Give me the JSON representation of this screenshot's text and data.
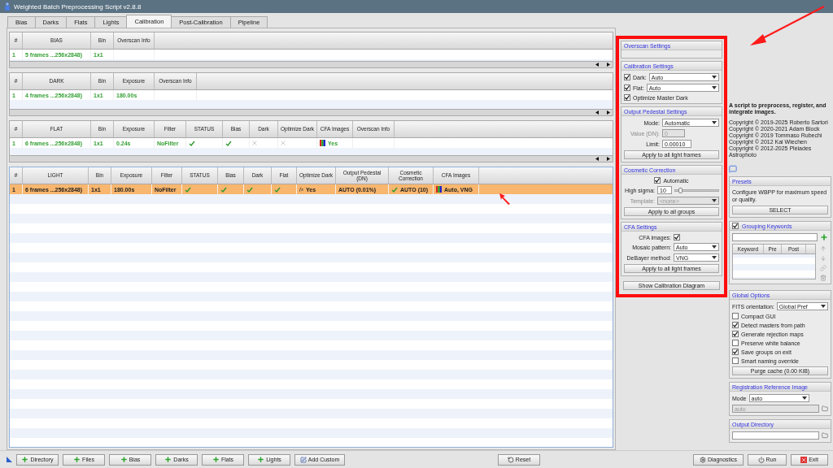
{
  "window": {
    "title": "Weighted Batch Preprocessing Script v2.8.8"
  },
  "tabs": [
    {
      "label": "Bias",
      "selected": false
    },
    {
      "label": "Darks",
      "selected": false
    },
    {
      "label": "Flats",
      "selected": false
    },
    {
      "label": "Lights",
      "selected": false
    },
    {
      "label": "Calibration",
      "selected": true
    },
    {
      "label": "Post-Calibration",
      "selected": false
    },
    {
      "label": "Pipeline",
      "selected": false
    }
  ],
  "tables": [
    {
      "columns": [
        "#",
        "BIAS",
        "Bin",
        "Overscan Info"
      ],
      "rows": [
        {
          "selected": false,
          "cells": [
            {
              "text": "1"
            },
            {
              "text": "5 frames ...256x2848)"
            },
            {
              "text": "1x1"
            },
            null
          ]
        }
      ]
    },
    {
      "columns": [
        "#",
        "DARK",
        "Bin",
        "Exposure",
        "Overscan Info"
      ],
      "rows": [
        {
          "selected": false,
          "cells": [
            {
              "text": "1"
            },
            {
              "text": "4 frames ...256x2848)"
            },
            {
              "text": "1x1"
            },
            {
              "text": "180.00s"
            },
            null
          ]
        }
      ]
    },
    {
      "columns": [
        "#",
        "FLAT",
        "Bin",
        "Exposure",
        "Filter",
        "STATUS",
        "Bias",
        "Dark",
        "Optimize Dark",
        "CFA Images",
        "Overscan Info"
      ],
      "rows": [
        {
          "selected": false,
          "cells": [
            {
              "text": "1"
            },
            {
              "text": "6 frames ...256x2848)"
            },
            {
              "text": "1x1"
            },
            {
              "text": "0.24s"
            },
            {
              "text": "NoFilter"
            },
            {
              "kind": "check"
            },
            {
              "kind": "check"
            },
            {
              "kind": "cross"
            },
            {
              "kind": "cross"
            },
            {
              "kind": "cfa",
              "text": "Yes"
            },
            null
          ]
        }
      ]
    },
    {
      "columns": [
        "#",
        "LIGHT",
        "Bin",
        "Exposure",
        "Filter",
        "STATUS",
        "Bias",
        "Dark",
        "Flat",
        "Optimize Dark",
        "Output Pedestal (DN)",
        "Cosmetic Correction",
        "CFA Images"
      ],
      "rows": [
        {
          "selected": true,
          "cells": [
            {
              "text": "1"
            },
            {
              "text": "6 frames ...256x2848)"
            },
            {
              "text": "1x1"
            },
            {
              "text": "180.00s"
            },
            {
              "text": "NoFilter"
            },
            {
              "kind": "check"
            },
            {
              "kind": "check"
            },
            {
              "kind": "check"
            },
            {
              "kind": "check"
            },
            {
              "prefix": "fx",
              "text": "Yes"
            },
            {
              "text": "AUTO (0.01%)"
            },
            {
              "kind": "check",
              "text": "AUTO (10)"
            },
            {
              "kind": "cfa",
              "text": "Auto, VNG"
            }
          ]
        }
      ]
    }
  ],
  "calibration_panel": {
    "highlighted": true,
    "overscan": {
      "title": "Overscan Settings"
    },
    "calibration": {
      "title": "Calibration Settings",
      "dark": {
        "label": "Dark:",
        "checked": true,
        "value": "Auto"
      },
      "flat": {
        "label": "Flat:",
        "checked": true,
        "value": "Auto"
      },
      "optimize": {
        "label": "Optimize Master Dark",
        "checked": true
      }
    },
    "pedestal": {
      "title": "Output Pedestal Settings",
      "mode_label": "Mode:",
      "mode_value": "Automatic",
      "value_label": "Value (DN):",
      "value": "0",
      "value_disabled": true,
      "limit_label": "Limit:",
      "limit_value": "0.00010",
      "button": "Apply to all light frames"
    },
    "cosmetic": {
      "title": "Cosmetic Correction",
      "automatic": {
        "label": "Automatic",
        "checked": true
      },
      "sigma_label": "High sigma:",
      "sigma_value": "10",
      "level": 0.12,
      "template_label": "Template:",
      "template_value": "<none>",
      "template_disabled": true,
      "button": "Apply to all groups"
    },
    "cfa": {
      "title": "CFA Settings",
      "cfa_label": "CFA images:",
      "cfa_checked": true,
      "mosaic_label": "Mosaic pattern:",
      "mosaic_value": "Auto",
      "debayer_label": "DeBayer method:",
      "debayer_value": "VNG",
      "button": "Apply to all light frames"
    },
    "diagram_button": "Show Calibration Diagram"
  },
  "info": {
    "description": "A script to preprocess, register, and integrate images.",
    "copyrights": [
      "Copyright © 2019-2025 Roberto Sartori",
      "Copyright © 2020-2021 Adam Block",
      "Copyright © 2019 Tommaso Rubechi",
      "Copyright © 2012 Kai Wiechen",
      "Copyright © 2012-2025 Pleiades Astrophoto"
    ]
  },
  "presets": {
    "title": "Presets",
    "text": "Configure WBPP for maximum speed or quality.",
    "button": "SELECT"
  },
  "grouping": {
    "title": "Grouping Keywords",
    "checked": true,
    "columns": [
      "Keyword",
      "Pre",
      "Post"
    ]
  },
  "global_options": {
    "title": "Global Options",
    "fits_label": "FITS orientation:",
    "fits_value": "Global Pref",
    "options": [
      {
        "label": "Compact GUI",
        "checked": false
      },
      {
        "label": "Detect masters from path",
        "checked": true
      },
      {
        "label": "Generate rejection maps",
        "checked": true
      },
      {
        "label": "Preserve white balance",
        "checked": false
      },
      {
        "label": "Save groups on exit",
        "checked": true
      },
      {
        "label": "Smart naming override",
        "checked": false
      }
    ],
    "purge_button": "Purge cache (0.00 KiB)"
  },
  "registration": {
    "title": "Registration Reference Image",
    "mode_label": "Mode",
    "mode_value": "auto",
    "field_value": "auto",
    "field_disabled": true
  },
  "output_directory": {
    "title": "Output Directory"
  },
  "bottom_left": [
    {
      "label": "Directory",
      "kind": "plus"
    },
    {
      "label": "Files",
      "kind": "plus"
    },
    {
      "label": "Bias",
      "kind": "plus"
    },
    {
      "label": "Darks",
      "kind": "plus"
    },
    {
      "label": "Flats",
      "kind": "plus"
    },
    {
      "label": "Lights",
      "kind": "plus"
    },
    {
      "label": "Add Custom",
      "kind": "edit"
    }
  ],
  "bottom_center": [
    {
      "label": "Reset",
      "kind": "reset"
    }
  ],
  "bottom_right": [
    {
      "label": "Diagnostics",
      "kind": "gear"
    },
    {
      "label": "Run",
      "kind": "power"
    },
    {
      "label": "Exit",
      "kind": "exit"
    }
  ]
}
